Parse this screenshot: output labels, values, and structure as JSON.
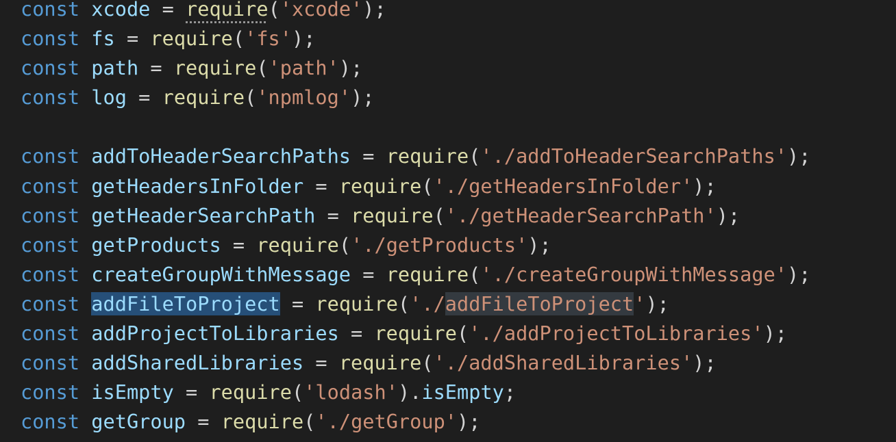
{
  "editor": {
    "theme_colors": {
      "background": "#1e1e1e",
      "keyword": "#569cd6",
      "variable": "#9cdcfe",
      "function": "#dcdcaa",
      "string": "#ce9178",
      "punctuation": "#d4d4d4",
      "selection": "#264f78",
      "occurrence_highlight": "#343a40"
    },
    "selected_identifier": "addFileToProject",
    "lines": [
      {
        "tokens": [
          {
            "t": "const",
            "k": "keyword"
          },
          {
            "t": " ",
            "k": "plain"
          },
          {
            "t": "xcode",
            "k": "variable"
          },
          {
            "t": " = ",
            "k": "plain"
          },
          {
            "t": "require",
            "k": "function",
            "hint": true
          },
          {
            "t": "(",
            "k": "plain"
          },
          {
            "t": "'xcode'",
            "k": "string"
          },
          {
            "t": ");",
            "k": "plain"
          }
        ]
      },
      {
        "tokens": [
          {
            "t": "const",
            "k": "keyword"
          },
          {
            "t": " ",
            "k": "plain"
          },
          {
            "t": "fs",
            "k": "variable"
          },
          {
            "t": " = ",
            "k": "plain"
          },
          {
            "t": "require",
            "k": "function"
          },
          {
            "t": "(",
            "k": "plain"
          },
          {
            "t": "'fs'",
            "k": "string"
          },
          {
            "t": ");",
            "k": "plain"
          }
        ]
      },
      {
        "tokens": [
          {
            "t": "const",
            "k": "keyword"
          },
          {
            "t": " ",
            "k": "plain"
          },
          {
            "t": "path",
            "k": "variable"
          },
          {
            "t": " = ",
            "k": "plain"
          },
          {
            "t": "require",
            "k": "function"
          },
          {
            "t": "(",
            "k": "plain"
          },
          {
            "t": "'path'",
            "k": "string"
          },
          {
            "t": ");",
            "k": "plain"
          }
        ]
      },
      {
        "tokens": [
          {
            "t": "const",
            "k": "keyword"
          },
          {
            "t": " ",
            "k": "plain"
          },
          {
            "t": "log",
            "k": "variable"
          },
          {
            "t": " = ",
            "k": "plain"
          },
          {
            "t": "require",
            "k": "function"
          },
          {
            "t": "(",
            "k": "plain"
          },
          {
            "t": "'npmlog'",
            "k": "string"
          },
          {
            "t": ");",
            "k": "plain"
          }
        ]
      },
      {
        "tokens": []
      },
      {
        "tokens": [
          {
            "t": "const",
            "k": "keyword"
          },
          {
            "t": " ",
            "k": "plain"
          },
          {
            "t": "addToHeaderSearchPaths",
            "k": "variable"
          },
          {
            "t": " = ",
            "k": "plain"
          },
          {
            "t": "require",
            "k": "function"
          },
          {
            "t": "(",
            "k": "plain"
          },
          {
            "t": "'./addToHeaderSearchPaths'",
            "k": "string"
          },
          {
            "t": ");",
            "k": "plain"
          }
        ]
      },
      {
        "tokens": [
          {
            "t": "const",
            "k": "keyword"
          },
          {
            "t": " ",
            "k": "plain"
          },
          {
            "t": "getHeadersInFolder",
            "k": "variable"
          },
          {
            "t": " = ",
            "k": "plain"
          },
          {
            "t": "require",
            "k": "function"
          },
          {
            "t": "(",
            "k": "plain"
          },
          {
            "t": "'./getHeadersInFolder'",
            "k": "string"
          },
          {
            "t": ");",
            "k": "plain"
          }
        ]
      },
      {
        "tokens": [
          {
            "t": "const",
            "k": "keyword"
          },
          {
            "t": " ",
            "k": "plain"
          },
          {
            "t": "getHeaderSearchPath",
            "k": "variable"
          },
          {
            "t": " = ",
            "k": "plain"
          },
          {
            "t": "require",
            "k": "function"
          },
          {
            "t": "(",
            "k": "plain"
          },
          {
            "t": "'./getHeaderSearchPath'",
            "k": "string"
          },
          {
            "t": ");",
            "k": "plain"
          }
        ]
      },
      {
        "tokens": [
          {
            "t": "const",
            "k": "keyword"
          },
          {
            "t": " ",
            "k": "plain"
          },
          {
            "t": "getProducts",
            "k": "variable"
          },
          {
            "t": " = ",
            "k": "plain"
          },
          {
            "t": "require",
            "k": "function"
          },
          {
            "t": "(",
            "k": "plain"
          },
          {
            "t": "'./getProducts'",
            "k": "string"
          },
          {
            "t": ");",
            "k": "plain"
          }
        ]
      },
      {
        "tokens": [
          {
            "t": "const",
            "k": "keyword"
          },
          {
            "t": " ",
            "k": "plain"
          },
          {
            "t": "createGroupWithMessage",
            "k": "variable"
          },
          {
            "t": " = ",
            "k": "plain"
          },
          {
            "t": "require",
            "k": "function"
          },
          {
            "t": "(",
            "k": "plain"
          },
          {
            "t": "'./createGroupWithMessage'",
            "k": "string"
          },
          {
            "t": ");",
            "k": "plain"
          }
        ]
      },
      {
        "tokens": [
          {
            "t": "const",
            "k": "keyword"
          },
          {
            "t": " ",
            "k": "plain"
          },
          {
            "t": "addFileToProject",
            "k": "variable",
            "hl": "selection"
          },
          {
            "t": " = ",
            "k": "plain"
          },
          {
            "t": "require",
            "k": "function"
          },
          {
            "t": "(",
            "k": "plain"
          },
          {
            "t": "'./",
            "k": "string"
          },
          {
            "t": "addFileToProject",
            "k": "string",
            "hl": "occurrence"
          },
          {
            "t": "'",
            "k": "string"
          },
          {
            "t": ");",
            "k": "plain"
          }
        ]
      },
      {
        "tokens": [
          {
            "t": "const",
            "k": "keyword"
          },
          {
            "t": " ",
            "k": "plain"
          },
          {
            "t": "addProjectToLibraries",
            "k": "variable"
          },
          {
            "t": " = ",
            "k": "plain"
          },
          {
            "t": "require",
            "k": "function"
          },
          {
            "t": "(",
            "k": "plain"
          },
          {
            "t": "'./addProjectToLibraries'",
            "k": "string"
          },
          {
            "t": ");",
            "k": "plain"
          }
        ]
      },
      {
        "tokens": [
          {
            "t": "const",
            "k": "keyword"
          },
          {
            "t": " ",
            "k": "plain"
          },
          {
            "t": "addSharedLibraries",
            "k": "variable"
          },
          {
            "t": " = ",
            "k": "plain"
          },
          {
            "t": "require",
            "k": "function"
          },
          {
            "t": "(",
            "k": "plain"
          },
          {
            "t": "'./addSharedLibraries'",
            "k": "string"
          },
          {
            "t": ");",
            "k": "plain"
          }
        ]
      },
      {
        "tokens": [
          {
            "t": "const",
            "k": "keyword"
          },
          {
            "t": " ",
            "k": "plain"
          },
          {
            "t": "isEmpty",
            "k": "variable"
          },
          {
            "t": " = ",
            "k": "plain"
          },
          {
            "t": "require",
            "k": "function"
          },
          {
            "t": "(",
            "k": "plain"
          },
          {
            "t": "'lodash'",
            "k": "string"
          },
          {
            "t": ").",
            "k": "plain"
          },
          {
            "t": "isEmpty",
            "k": "variable"
          },
          {
            "t": ";",
            "k": "plain"
          }
        ]
      },
      {
        "tokens": [
          {
            "t": "const",
            "k": "keyword"
          },
          {
            "t": " ",
            "k": "plain"
          },
          {
            "t": "getGroup",
            "k": "variable"
          },
          {
            "t": " = ",
            "k": "plain"
          },
          {
            "t": "require",
            "k": "function"
          },
          {
            "t": "(",
            "k": "plain"
          },
          {
            "t": "'./getGroup'",
            "k": "string"
          },
          {
            "t": ");",
            "k": "plain"
          }
        ]
      }
    ]
  }
}
